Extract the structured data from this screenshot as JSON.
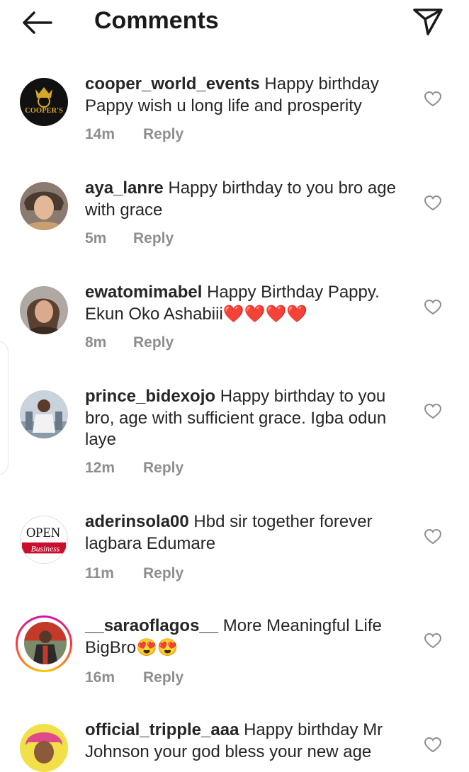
{
  "header": {
    "title": "Comments",
    "back_icon": "arrow-left-icon",
    "share_icon": "paper-plane-icon"
  },
  "comments": [
    {
      "username": "cooper_world_events",
      "text": "Happy birthday Pappy wish u long life and prosperity",
      "time": "14m",
      "reply": "Reply",
      "avatar_text": "COOPER'S"
    },
    {
      "username": "aya_lanre",
      "text": "Happy birthday to you bro age with grace",
      "time": "5m",
      "reply": "Reply"
    },
    {
      "username": "ewatomimabel",
      "text": "Happy Birthday Pappy. Ekun Oko Ashabiii❤️❤️❤️❤️",
      "time": "8m",
      "reply": "Reply"
    },
    {
      "username": "prince_bidexojo",
      "text": "Happy birthday to you bro, age with sufficient grace. Igba odun laye",
      "time": "12m",
      "reply": "Reply"
    },
    {
      "username": "aderinsola00",
      "text": "Hbd sir together forever lagbara Edumare",
      "time": "11m",
      "reply": "Reply",
      "avatar_text": "OPEN",
      "avatar_subtext": "Business"
    },
    {
      "username": "__saraoflagos__",
      "text": "More Meaningful Life BigBro😍😍",
      "time": "16m",
      "reply": "Reply"
    },
    {
      "username": "official_tripple_aaa",
      "text": "Happy birthday Mr Johnson your god bless your new age",
      "time": "",
      "reply": ""
    }
  ],
  "colors": {
    "text": "#262626",
    "meta": "#8e8e8e",
    "story_ring": [
      "#c913b9",
      "#f9373f",
      "#fecd00"
    ]
  }
}
